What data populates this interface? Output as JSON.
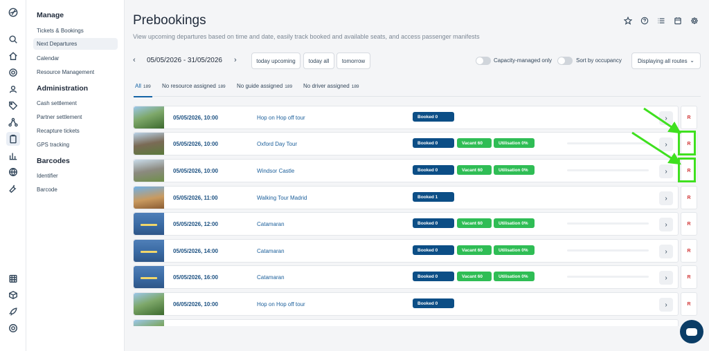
{
  "rail": {
    "icons": [
      "logo-icon",
      "search-icon",
      "home-icon",
      "settings-icon",
      "user-icon",
      "tag-icon",
      "network-icon",
      "clipboard-icon",
      "chart-icon",
      "globe-icon",
      "wrench-icon",
      "calendar-grid-icon",
      "cube-icon",
      "rocket-icon",
      "support-icon"
    ]
  },
  "subnav": {
    "manage_title": "Manage",
    "manage_items": [
      "Tickets & Bookings",
      "Next Departures",
      "Calendar",
      "Resource Management"
    ],
    "admin_title": "Administration",
    "admin_items": [
      "Cash settlement",
      "Partner settlement",
      "Recapture tickets",
      "GPS tracking"
    ],
    "barcodes_title": "Barcodes",
    "barcode_items": [
      "Identifier",
      "Barcode"
    ]
  },
  "header": {
    "title": "Prebookings",
    "subtitle": "View upcoming departures based on time and date, easily track booked and available seats, and access passenger manifests",
    "icons": [
      "star-icon",
      "help-icon",
      "list-icon",
      "calendar-icon",
      "gear-icon"
    ]
  },
  "filters": {
    "date_range": "05/05/2026 - 31/05/2026",
    "today_upcoming": "today upcoming",
    "today_all": "today all",
    "tomorrow": "tomorrow",
    "capacity_label": "Capacity-managed only",
    "occupancy_label": "Sort by occupancy",
    "routes_label": "Displaying all routes",
    "capacity_on": false,
    "occupancy_on": false
  },
  "tabs": [
    {
      "label": "All",
      "count": "189"
    },
    {
      "label": "No resource assigned",
      "count": "189"
    },
    {
      "label": "No guide assigned",
      "count": "189"
    },
    {
      "label": "No driver assigned",
      "count": "189"
    }
  ],
  "departures": [
    {
      "datetime": "05/05/2026, 10:00",
      "tour": "Hop on Hop off tour",
      "booked": "Booked 0",
      "vacant": "",
      "utilisation": "",
      "thumb": "green",
      "action": "R",
      "highlighted": false
    },
    {
      "datetime": "05/05/2026, 10:00",
      "tour": "Oxford Day Tour",
      "booked": "Booked 0",
      "vacant": "Vacant 60",
      "utilisation": "Utilisation 0%",
      "thumb": "castle",
      "action": "R",
      "highlighted": true
    },
    {
      "datetime": "05/05/2026, 10:00",
      "tour": "Windsor Castle",
      "booked": "Booked 0",
      "vacant": "Vacant 60",
      "utilisation": "Utilisation 0%",
      "thumb": "windsor",
      "action": "R",
      "highlighted": true
    },
    {
      "datetime": "05/05/2026, 11:00",
      "tour": "Walking Tour Madrid",
      "booked": "Booked 1",
      "vacant": "",
      "utilisation": "",
      "thumb": "madrid",
      "action": "R",
      "highlighted": false
    },
    {
      "datetime": "05/05/2026, 12:00",
      "tour": "Catamaran",
      "booked": "Booked 0",
      "vacant": "Vacant 60",
      "utilisation": "Utilisation 0%",
      "thumb": "boat",
      "action": "R",
      "highlighted": false
    },
    {
      "datetime": "05/05/2026, 14:00",
      "tour": "Catamaran",
      "booked": "Booked 0",
      "vacant": "Vacant 60",
      "utilisation": "Utilisation 0%",
      "thumb": "boat",
      "action": "R",
      "highlighted": false
    },
    {
      "datetime": "05/05/2026, 16:00",
      "tour": "Catamaran",
      "booked": "Booked 0",
      "vacant": "Vacant 60",
      "utilisation": "Utilisation 0%",
      "thumb": "boat",
      "action": "R",
      "highlighted": false
    },
    {
      "datetime": "06/05/2026, 10:00",
      "tour": "Hop on Hop off tour",
      "booked": "Booked 0",
      "vacant": "",
      "utilisation": "",
      "thumb": "green",
      "action": "R",
      "highlighted": false
    },
    {
      "datetime": "",
      "tour": "",
      "booked": "",
      "vacant": "",
      "utilisation": "",
      "thumb": "green",
      "action": "",
      "highlighted": false
    }
  ],
  "colors": {
    "booked": "#0c4e86",
    "vacant": "#2fbd55",
    "highlight": "#3fe01f",
    "action_text": "#d23a3a"
  }
}
